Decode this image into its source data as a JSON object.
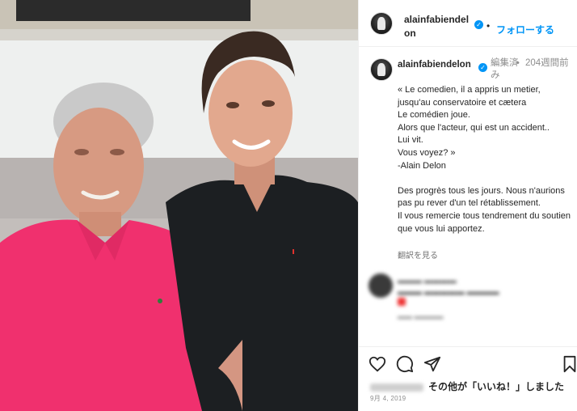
{
  "post": {
    "header": {
      "username": "alainfabiendelon",
      "dot": "•",
      "follow_label": "フォローする"
    },
    "caption": {
      "username": "alainfabiendelon",
      "edited": "編集済み",
      "separator": "•",
      "time": "204週間前",
      "text": "« Le comedien, il a appris un metier, jusqu'au conservatoire et cætera\nLe comédien joue.\nAlors que l'acteur, qui est un accident..\nLui vit.\nVous voyez? »\n-Alain Delon\n\nDes progrès tous les jours. Nous n'aurions pas pu rever d'un tel rétablissement.\nIl vous remercie tous tendrement du soutien que vous lui apportez.",
      "translate_label": "翻訳を見る"
    },
    "actions": {
      "like_icon": "heart-icon",
      "comment_icon": "comment-icon",
      "share_icon": "share-icon",
      "save_icon": "bookmark-icon",
      "likes_text": "その他が「いいね！」しました",
      "date": "9月 4, 2019"
    },
    "colors": {
      "accent": "#0095f6",
      "verified_badge": "#0095f6",
      "shirt_pink": "#f0306e",
      "shirt_black": "#1c1f22"
    }
  }
}
